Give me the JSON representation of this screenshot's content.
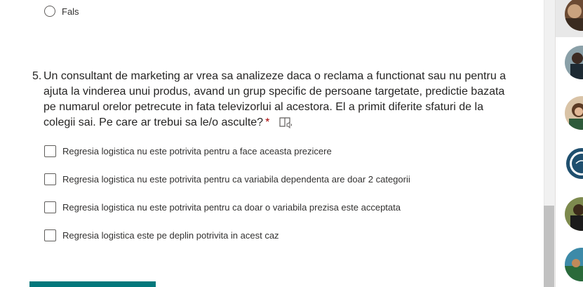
{
  "previous_question": {
    "option_label": "Fals"
  },
  "question": {
    "number": "5.",
    "text": "Un consultant de marketing ar vrea sa analizeze daca o reclama a functionat sau nu pentru a ajuta la vinderea unui produs, avand un grup specific de persoane targetate, predictie bazata pe numarul orelor petrecute in fata televizorlui al acestora. El a primit diferite sfaturi de la colegii sai. Pe care ar trebui sa le/o asculte?",
    "required_marker": "*",
    "options": [
      {
        "label": "Regresia logistica nu este potrivita pentru a face aceasta prezicere",
        "checked": false
      },
      {
        "label": "Regresia logistica nu este potrivita pentru ca variabila dependenta are doar 2 categorii",
        "checked": false
      },
      {
        "label": "Regresia logistica nu este potrivita pentru ca doar o variabila prezisa este acceptata",
        "checked": false
      },
      {
        "label": "Regresia logistica este pe deplin potrivita in acest caz",
        "checked": false
      }
    ]
  },
  "theme": {
    "accent": "#03787c",
    "required": "#a80000",
    "scrollbar_thumb": "#c1c1c1"
  },
  "icons": {
    "reader": "immersive-reader-icon"
  }
}
